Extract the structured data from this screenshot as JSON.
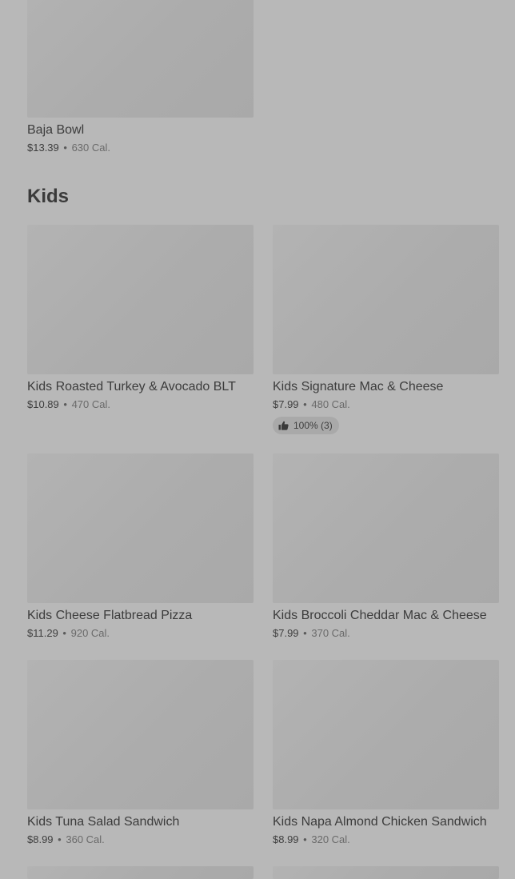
{
  "top_item": {
    "name": "Baja Bowl",
    "price": "$13.39",
    "calories": "630 Cal."
  },
  "section": {
    "title": "Kids"
  },
  "items": [
    {
      "name": "Kids Roasted Turkey & Avocado BLT",
      "price": "$10.89",
      "calories": "470 Cal."
    },
    {
      "name": "Kids Signature Mac & Cheese",
      "price": "$7.99",
      "calories": "480 Cal.",
      "rating": "100% (3)",
      "rating_icon": "thumbs-up-icon"
    },
    {
      "name": "Kids Cheese Flatbread Pizza",
      "price": "$11.29",
      "calories": "920 Cal."
    },
    {
      "name": "Kids Broccoli Cheddar Mac & Cheese",
      "price": "$7.99",
      "calories": "370 Cal."
    },
    {
      "name": "Kids Tuna Salad Sandwich",
      "price": "$8.99",
      "calories": "360 Cal."
    },
    {
      "name": "Kids Napa Almond Chicken Sandwich",
      "price": "$8.99",
      "calories": "320 Cal."
    }
  ],
  "separator": "•"
}
